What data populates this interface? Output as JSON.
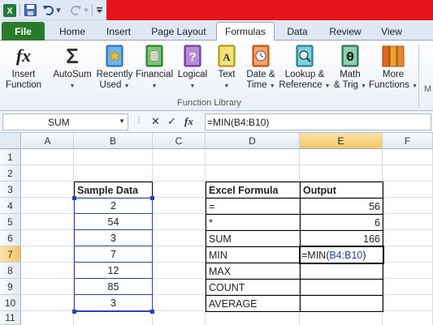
{
  "qat": {
    "app_icon": "excel-x-icon",
    "save_icon": "save-icon",
    "undo_icon": "undo-icon",
    "redo_icon": "redo-icon",
    "customize_icon": "customize-qat-icon"
  },
  "tabs": [
    {
      "label": "File"
    },
    {
      "label": "Home"
    },
    {
      "label": "Insert"
    },
    {
      "label": "Page Layout"
    },
    {
      "label": "Formulas"
    },
    {
      "label": "Data"
    },
    {
      "label": "Review"
    },
    {
      "label": "View"
    }
  ],
  "ribbon": {
    "insert_function": {
      "line1": "Insert",
      "line2": "Function"
    },
    "autosum": {
      "label": "AutoSum"
    },
    "recently_used": {
      "line1": "Recently",
      "line2": "Used"
    },
    "financial": {
      "label": "Financial"
    },
    "logical": {
      "label": "Logical"
    },
    "text": {
      "label": "Text"
    },
    "date_time": {
      "line1": "Date &",
      "line2": "Time"
    },
    "lookup": {
      "line1": "Lookup &",
      "line2": "Reference"
    },
    "math": {
      "line1": "Math",
      "line2": "& Trig"
    },
    "more": {
      "line1": "More",
      "line2": "Functions"
    },
    "group_label": "Function Library",
    "next_group_letter": "M"
  },
  "formula_bar": {
    "name_box": "SUM",
    "fx": "fx",
    "formula": "=MIN(B4:B10)"
  },
  "columns": [
    "A",
    "B",
    "C",
    "D",
    "E",
    "F"
  ],
  "rows": [
    "1",
    "2",
    "3",
    "4",
    "5",
    "6",
    "7",
    "8",
    "9",
    "10",
    "11"
  ],
  "sheet": {
    "b3": "Sample Data",
    "b_values": [
      "2",
      "54",
      "3",
      "7",
      "12",
      "85",
      "3"
    ],
    "d3": "Excel Formula",
    "e3": "Output",
    "d_values": [
      "=",
      "*",
      "SUM",
      "MIN",
      "MAX",
      "COUNT",
      "AVERAGE"
    ],
    "e4": "56",
    "e5": "6",
    "e6": "166",
    "e7_prefix": "=MIN(",
    "e7_ref": "B4:B10",
    "e7_suffix": ")"
  },
  "colors": {
    "file_tab": "#2b7a2b",
    "title_bar": "#e8141b",
    "ref_blue": "#2b3fb5",
    "selected_header": "#f3c766"
  }
}
